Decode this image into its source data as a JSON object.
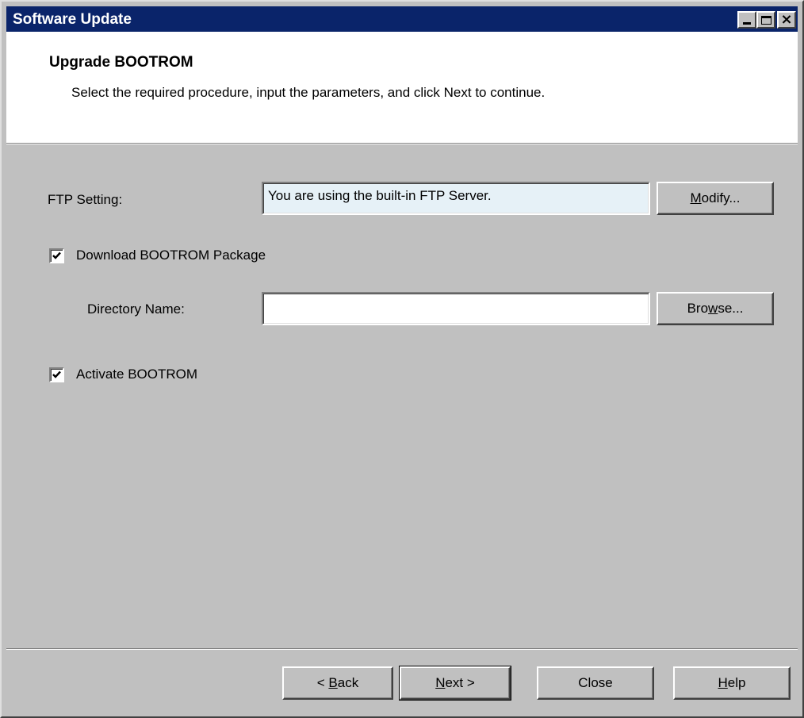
{
  "window": {
    "title": "Software Update",
    "buttons": {
      "minimize": "minimize",
      "maximize": "maximize",
      "close": "×"
    }
  },
  "header": {
    "title": "Upgrade BOOTROM",
    "subtitle": "Select the required procedure, input the parameters, and click Next to continue."
  },
  "form": {
    "ftp_label": "FTP Setting:",
    "ftp_value": "You are using the built-in FTP Server.",
    "modify_prefix": "",
    "modify_mnemonic": "M",
    "modify_suffix": "odify...",
    "download_checkbox_label": "Download BOOTROM Package",
    "download_checked": true,
    "directory_label": "Directory Name:",
    "directory_value": "",
    "browse_prefix": "Bro",
    "browse_mnemonic": "w",
    "browse_suffix": "se...",
    "activate_checkbox_label": "Activate BOOTROM",
    "activate_checked": true
  },
  "footer": {
    "back_prefix": "< ",
    "back_mnemonic": "B",
    "back_suffix": "ack",
    "next_prefix": "",
    "next_mnemonic": "N",
    "next_suffix": "ext >",
    "close_label": "Close",
    "help_prefix": "",
    "help_mnemonic": "H",
    "help_suffix": "elp"
  },
  "colors": {
    "titlebar": "#0a246a",
    "face": "#c0c0c0",
    "ftp_field_bg": "#e6f1f7"
  },
  "icons": {
    "checkmark": "checkmark-icon"
  }
}
